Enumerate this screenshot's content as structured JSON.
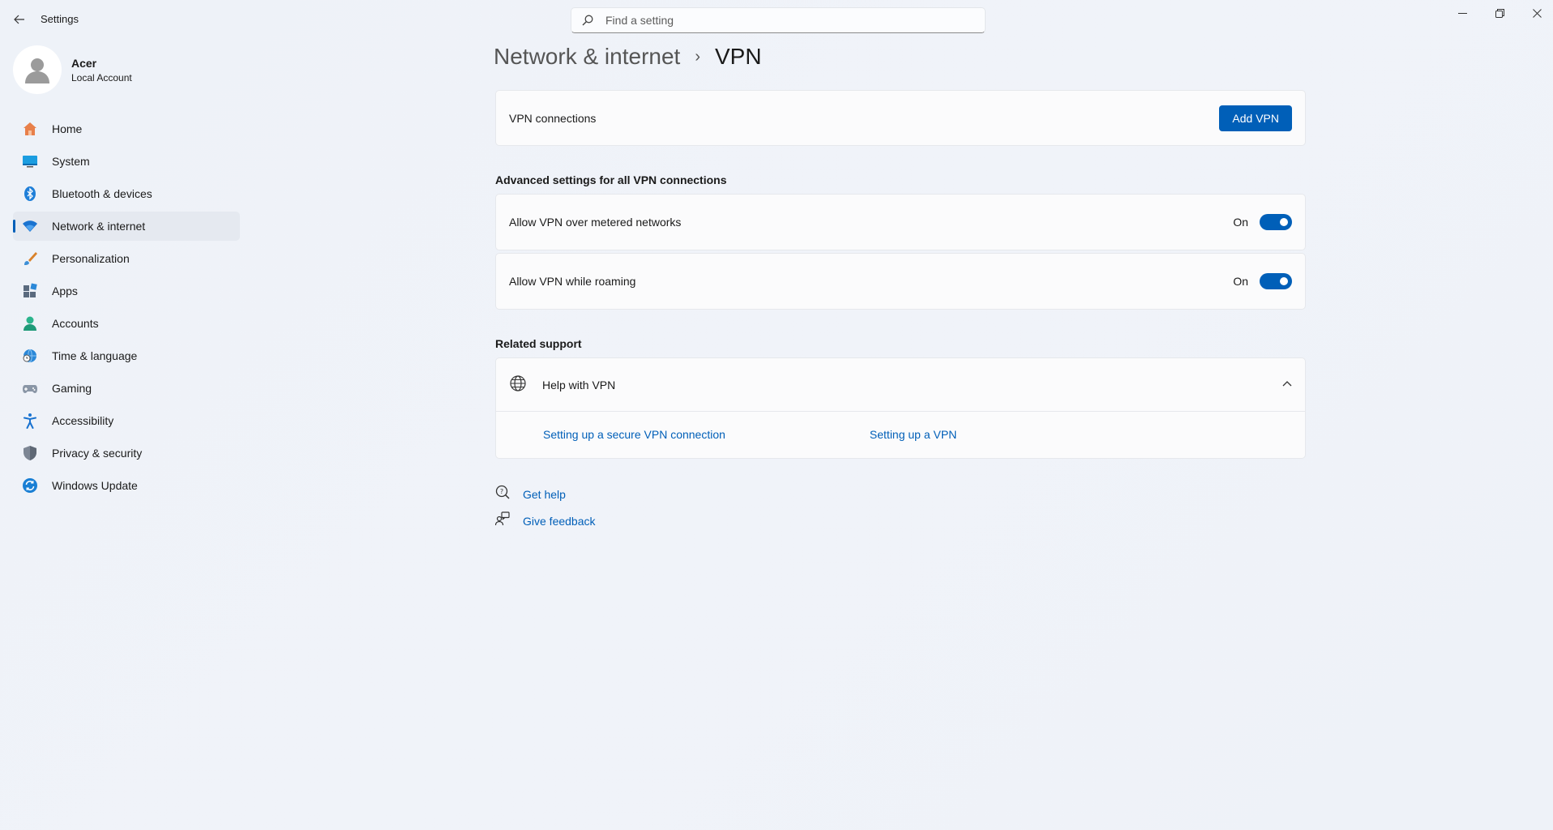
{
  "app": {
    "title": "Settings"
  },
  "search": {
    "placeholder": "Find a setting"
  },
  "profile": {
    "name": "Acer",
    "account_type": "Local Account"
  },
  "nav": {
    "items": [
      {
        "label": "Home",
        "icon": "home-icon"
      },
      {
        "label": "System",
        "icon": "system-icon"
      },
      {
        "label": "Bluetooth & devices",
        "icon": "bluetooth-icon"
      },
      {
        "label": "Network & internet",
        "icon": "wifi-icon",
        "active": true
      },
      {
        "label": "Personalization",
        "icon": "brush-icon"
      },
      {
        "label": "Apps",
        "icon": "apps-icon"
      },
      {
        "label": "Accounts",
        "icon": "accounts-icon"
      },
      {
        "label": "Time & language",
        "icon": "globe-clock-icon"
      },
      {
        "label": "Gaming",
        "icon": "gamepad-icon"
      },
      {
        "label": "Accessibility",
        "icon": "accessibility-icon"
      },
      {
        "label": "Privacy & security",
        "icon": "shield-icon"
      },
      {
        "label": "Windows Update",
        "icon": "update-icon"
      }
    ]
  },
  "breadcrumb": {
    "parent": "Network & internet",
    "separator": "›",
    "current": "VPN"
  },
  "vpn": {
    "connections_label": "VPN connections",
    "add_button": "Add VPN"
  },
  "advanced": {
    "heading": "Advanced settings for all VPN connections",
    "metered": {
      "label": "Allow VPN over metered networks",
      "state": "On",
      "value": true
    },
    "roaming": {
      "label": "Allow VPN while roaming",
      "state": "On",
      "value": true
    }
  },
  "support": {
    "heading": "Related support",
    "help_title": "Help with VPN",
    "links": [
      "Setting up a secure VPN connection",
      "Setting up a VPN"
    ]
  },
  "footer": {
    "get_help": "Get help",
    "give_feedback": "Give feedback"
  },
  "colors": {
    "accent": "#005fb8",
    "background": "#eef2f8"
  }
}
